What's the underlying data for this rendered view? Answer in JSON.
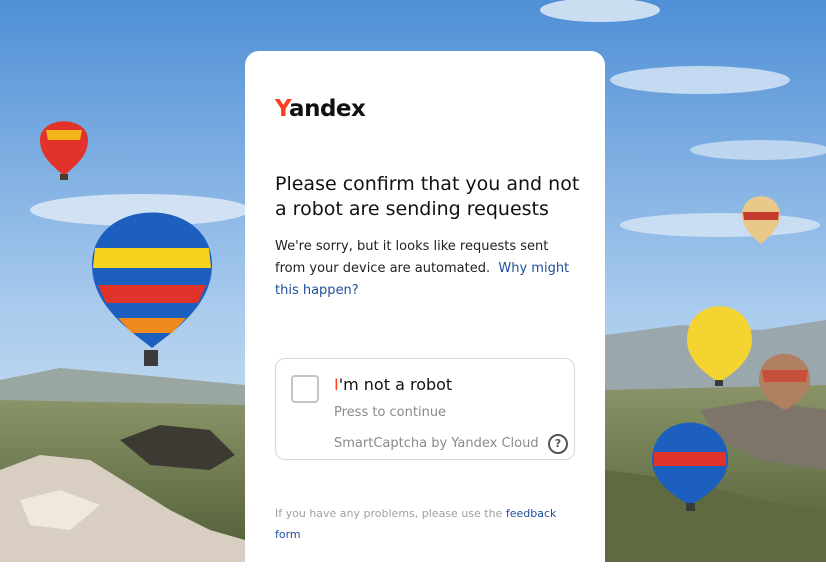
{
  "logo": {
    "first_letter": "Y",
    "rest": "andex",
    "brand_color": "#fc3f1d"
  },
  "heading": "Please confirm that you and not a robot are sending requests",
  "description": {
    "text": "We're sorry, but it looks like requests sent from your device are automated.",
    "link": "Why might this happen?"
  },
  "captcha": {
    "label_first": "I",
    "label_rest": "'m not a robot",
    "subtitle": "Press to continue",
    "brand": "SmartCaptcha by Yandex Cloud",
    "help_symbol": "?",
    "checked": false
  },
  "footer": {
    "text": "If you have any problems, please use the",
    "link": "feedback form"
  },
  "colors": {
    "accent": "#fc3f1d",
    "link": "#1f4f9c",
    "sky": "#6aa0dc"
  }
}
